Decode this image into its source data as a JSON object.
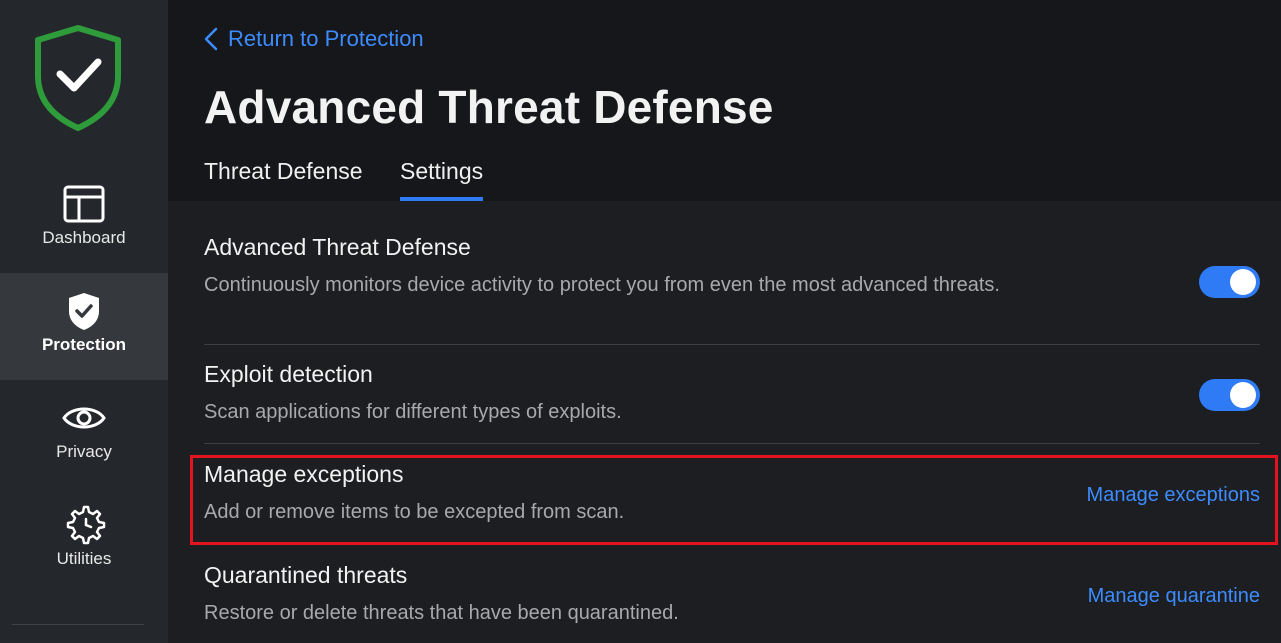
{
  "sidebar": {
    "logo_icon": "shield-check-icon",
    "items": [
      {
        "label": "Dashboard",
        "icon": "dashboard-icon"
      },
      {
        "label": "Protection",
        "icon": "shield-icon",
        "active": true
      },
      {
        "label": "Privacy",
        "icon": "eye-icon"
      },
      {
        "label": "Utilities",
        "icon": "utilities-icon"
      }
    ]
  },
  "header": {
    "back_label": "Return to Protection",
    "title": "Advanced Threat Defense",
    "tabs": [
      {
        "label": "Threat Defense"
      },
      {
        "label": "Settings",
        "active": true
      }
    ]
  },
  "settings": [
    {
      "title": "Advanced Threat Defense",
      "description": "Continuously monitors device activity to protect you from even the most advanced threats.",
      "toggle": true
    },
    {
      "title": "Exploit detection",
      "description": "Scan applications for different types of exploits.",
      "toggle": true
    },
    {
      "title": "Manage exceptions",
      "description": "Add or remove items to be excepted from scan.",
      "action_label": "Manage exceptions"
    },
    {
      "title": "Quarantined threats",
      "description": "Restore or delete threats that have been quarantined.",
      "action_label": "Manage quarantine"
    }
  ],
  "colors": {
    "accent": "#2f7bf5",
    "link": "#3d8cff",
    "shield_green": "#2e9c3a",
    "highlight_red": "#e3141d"
  }
}
